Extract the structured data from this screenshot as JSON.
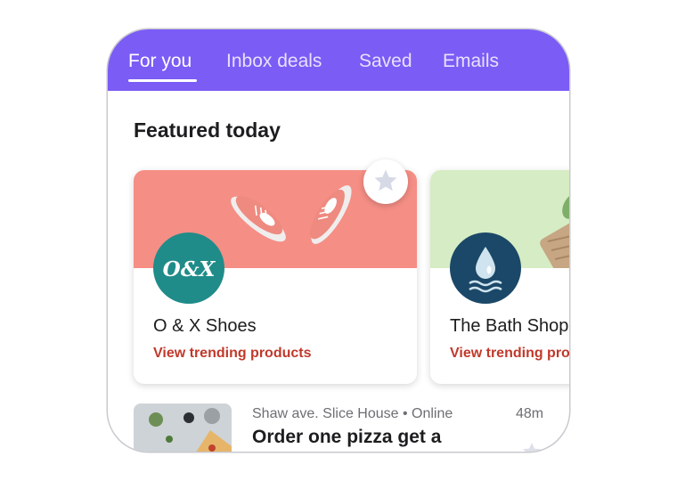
{
  "tabs": [
    {
      "label": "For you",
      "active": true
    },
    {
      "label": "Inbox deals",
      "active": false
    },
    {
      "label": "Saved",
      "active": false
    },
    {
      "label": "Emails",
      "active": false
    }
  ],
  "featured": {
    "title": "Featured today",
    "cards": [
      {
        "name": "O & X Shoes",
        "link": "View trending products",
        "logo_text": "O&X",
        "logo_icon": "ox-shoes-logo",
        "hero_icon": "sneakers-image",
        "accent": "#f58e85"
      },
      {
        "name": "The Bath Shop",
        "link": "View trending products",
        "logo_icon": "water-drop-logo",
        "hero_icon": "bath-products-image",
        "accent": "#d6ecc4"
      }
    ],
    "save_icon": "star-icon"
  },
  "deal": {
    "meta": "Shaw ave. Slice House • Online",
    "time": "48m",
    "title": "Order one pizza get a",
    "thumb_icon": "pizza-image"
  },
  "colors": {
    "header": "#7b5cf5",
    "link": "#c0392b",
    "text": "#1d1d1f",
    "muted": "#6e6e73"
  }
}
